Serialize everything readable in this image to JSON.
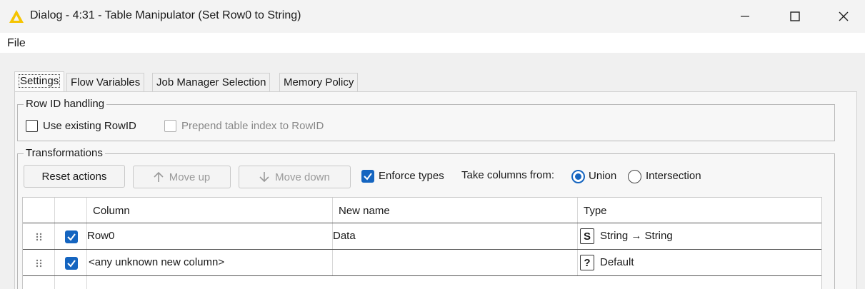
{
  "window": {
    "title": "Dialog - 4:31 - Table Manipulator (Set Row0 to String)",
    "accent_color": "#f5c400"
  },
  "menu": {
    "file_label": "File"
  },
  "tabs": [
    {
      "label": "Settings",
      "active": true
    },
    {
      "label": "Flow Variables",
      "active": false
    },
    {
      "label": "Job Manager Selection",
      "active": false
    },
    {
      "label": "Memory Policy",
      "active": false
    }
  ],
  "row_id_handling": {
    "title": "Row ID handling",
    "use_existing_label": "Use existing RowID",
    "use_existing_checked": false,
    "prepend_label": "Prepend table index to RowID",
    "prepend_checked": false,
    "prepend_enabled": false
  },
  "transformations": {
    "title": "Transformations",
    "reset_label": "Reset actions",
    "move_up_label": "Move up",
    "move_down_label": "Move down",
    "enforce_types_label": "Enforce types",
    "enforce_types_checked": true,
    "take_columns_label": "Take columns from:",
    "union_label": "Union",
    "intersection_label": "Intersection",
    "selected_mode": "Union",
    "check_color": "#1565c0"
  },
  "table": {
    "headers": {
      "column": "Column",
      "new_name": "New name",
      "type": "Type"
    },
    "rows": [
      {
        "column": "Row0",
        "new_name": "Data",
        "type_icon": "S",
        "type": "String → String",
        "checked": true
      },
      {
        "column": "<any unknown new column>",
        "new_name": "",
        "type_icon": "?",
        "type": "Default",
        "checked": true
      }
    ]
  }
}
